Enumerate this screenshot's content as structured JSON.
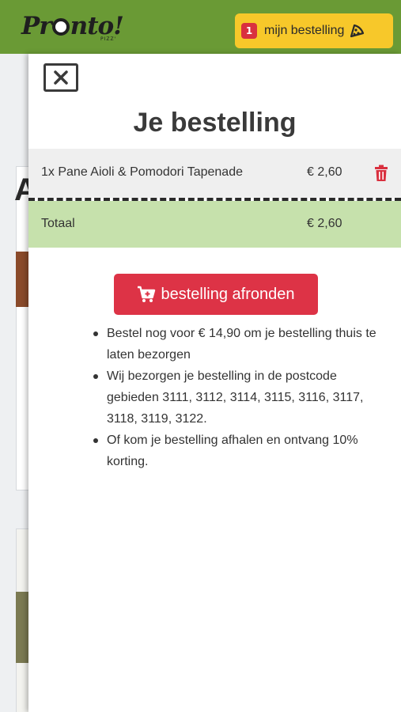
{
  "header": {
    "logo": {
      "text_before": "Pr",
      "text_after": "nto!",
      "subtext": "PIZZ'"
    },
    "order_button": {
      "count": "1",
      "label": "mijn bestelling",
      "icon": "pizza-slice-icon"
    }
  },
  "colors": {
    "header_bg": "#6a9a35",
    "order_button_bg": "#f7c82a",
    "badge_bg": "#d9303f",
    "checkout_bg": "#dd3346",
    "total_row_bg": "#c6e1ac",
    "item_row_bg": "#efefef"
  },
  "background_page": {
    "letter": "A"
  },
  "panel": {
    "close_icon": "close-icon",
    "title": "Je bestelling",
    "items": [
      {
        "name": "1x Pane Aioli & Pomodori Tapenade",
        "price": "€ 2,60",
        "delete_icon": "trash-icon"
      }
    ],
    "total": {
      "label": "Totaal",
      "price": "€ 2,60"
    },
    "checkout": {
      "label": "bestelling afronden",
      "icon": "cart-plus-icon"
    },
    "info": [
      "Bestel nog voor € 14,90 om je bestelling thuis te laten bezorgen",
      "Wij bezorgen je bestelling in de postcode gebieden 3111, 3112, 3114, 3115, 3116, 3117, 3118, 3119, 3122.",
      "Of kom je bestelling afhalen en ontvang 10% korting."
    ]
  }
}
